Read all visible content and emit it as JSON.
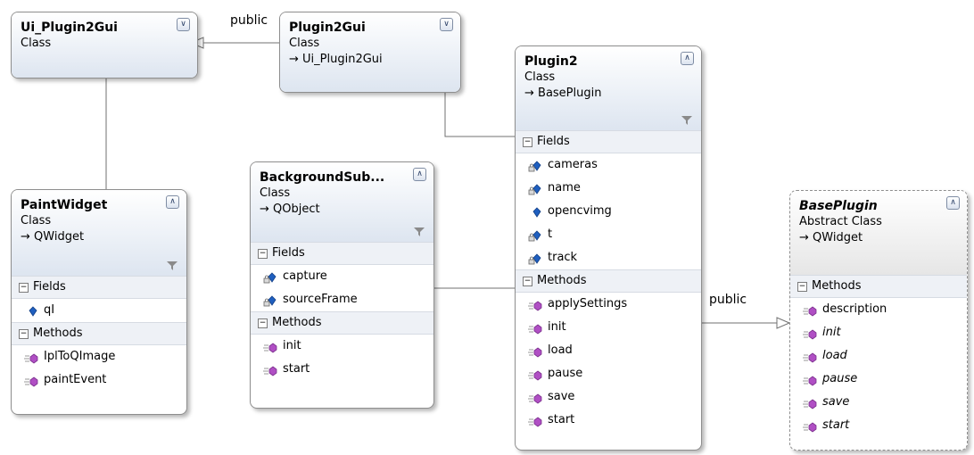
{
  "diagram": {
    "edge_labels": {
      "plugin2gui_to_ui": "public",
      "plugin2_to_baseplugin": "public"
    },
    "classes": {
      "ui_plugin2gui": {
        "name": "Ui_Plugin2Gui",
        "kind": "Class",
        "toggle": "expand"
      },
      "plugin2gui": {
        "name": "Plugin2Gui",
        "kind": "Class",
        "base": "→ Ui_Plugin2Gui",
        "toggle": "expand"
      },
      "paintwidget": {
        "name": "PaintWidget",
        "kind": "Class",
        "base": "→ QWidget",
        "toggle": "collapse",
        "fields_label": "Fields",
        "methods_label": "Methods",
        "fields": [
          {
            "name": "qI",
            "icon": "field-icon"
          }
        ],
        "methods": [
          {
            "name": "IplToQImage",
            "icon": "method-icon"
          },
          {
            "name": "paintEvent",
            "icon": "method-icon"
          }
        ]
      },
      "backgroundsub": {
        "name": "BackgroundSub...",
        "kind": "Class",
        "base": "→ QObject",
        "toggle": "collapse",
        "fields_label": "Fields",
        "methods_label": "Methods",
        "fields": [
          {
            "name": "capture",
            "icon": "private-field-icon"
          },
          {
            "name": "sourceFrame",
            "icon": "private-field-icon"
          }
        ],
        "methods": [
          {
            "name": "init",
            "icon": "method-icon"
          },
          {
            "name": "start",
            "icon": "method-icon"
          }
        ]
      },
      "plugin2": {
        "name": "Plugin2",
        "kind": "Class",
        "base": "→ BasePlugin",
        "toggle": "collapse",
        "fields_label": "Fields",
        "methods_label": "Methods",
        "fields": [
          {
            "name": "cameras",
            "icon": "private-field-icon"
          },
          {
            "name": "name",
            "icon": "private-field-icon"
          },
          {
            "name": "opencvimg",
            "icon": "field-icon"
          },
          {
            "name": "t",
            "icon": "private-field-icon"
          },
          {
            "name": "track",
            "icon": "private-field-icon"
          }
        ],
        "methods": [
          {
            "name": "applySettings",
            "icon": "method-icon"
          },
          {
            "name": "init",
            "icon": "method-icon"
          },
          {
            "name": "load",
            "icon": "method-icon"
          },
          {
            "name": "pause",
            "icon": "method-icon"
          },
          {
            "name": "save",
            "icon": "method-icon"
          },
          {
            "name": "start",
            "icon": "method-icon"
          }
        ]
      },
      "baseplugin": {
        "name": "BasePlugin",
        "kind": "Abstract Class",
        "base": "→ QWidget",
        "toggle": "collapse",
        "methods_label": "Methods",
        "methods": [
          {
            "name": "description",
            "icon": "method-icon",
            "italic": false
          },
          {
            "name": "init",
            "icon": "method-icon",
            "italic": true
          },
          {
            "name": "load",
            "icon": "method-icon",
            "italic": true
          },
          {
            "name": "pause",
            "icon": "method-icon",
            "italic": true
          },
          {
            "name": "save",
            "icon": "method-icon",
            "italic": true
          },
          {
            "name": "start",
            "icon": "method-icon",
            "italic": true
          }
        ]
      }
    },
    "colors": {
      "connector": "#707070",
      "header_gradient_end": "#dde5f0",
      "section_bg": "#eef1f6",
      "field_icon": "#1f5fbf",
      "method_icon": "#b04fc4"
    }
  }
}
